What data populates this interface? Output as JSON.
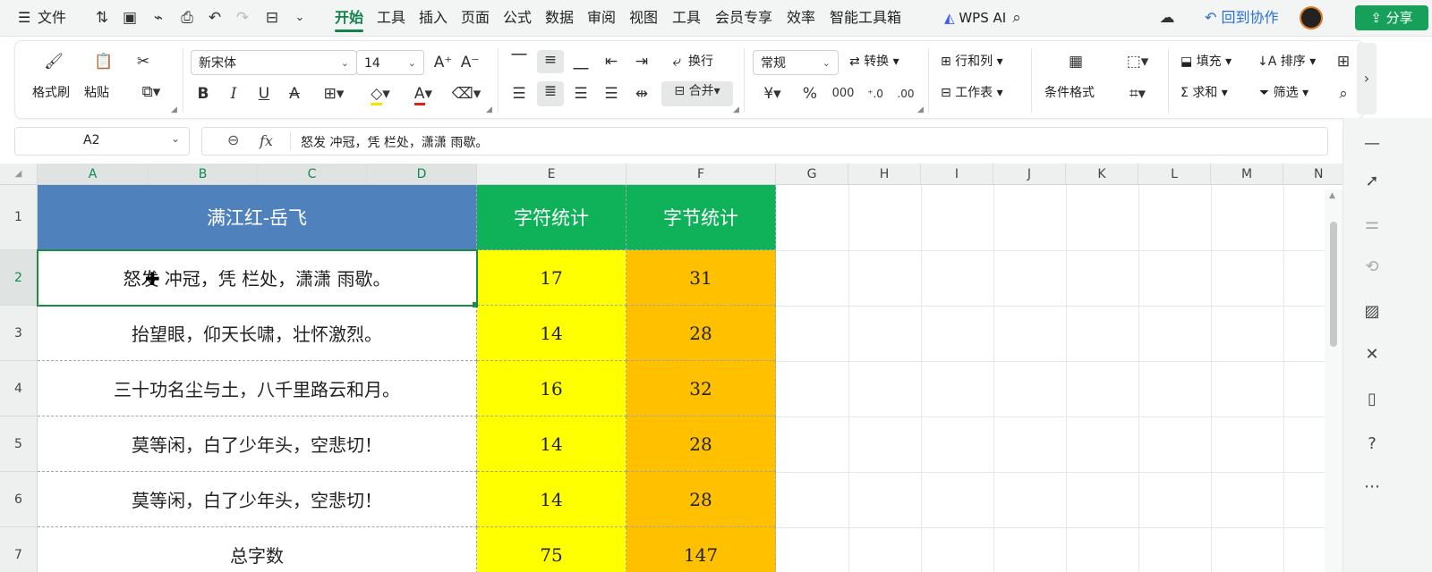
{
  "menubar": {
    "file_label": "文件",
    "tabs": [
      "开始",
      "工具",
      "插入",
      "页面",
      "公式",
      "数据",
      "审阅",
      "视图",
      "工具",
      "会员专享",
      "效率",
      "智能工具箱"
    ],
    "active_tab": "开始",
    "wps_ai": "WPS AI",
    "back_to_collab": "回到协作",
    "share": "分享"
  },
  "ribbon": {
    "format_painter": "格式刷",
    "paste": "粘贴",
    "font_name": "新宋体",
    "font_size": "14",
    "wrap": "换行",
    "merge": "合并",
    "number_format": "常规",
    "convert": "转换",
    "row_col": "行和列",
    "worksheet": "工作表",
    "cond_format": "条件格式",
    "fill": "填充",
    "sort": "排序",
    "sum": "求和",
    "filter": "筛选"
  },
  "formula_bar": {
    "name_box": "A2",
    "fx": "fx",
    "content": "怒发 冲冠，凭 栏处，潇潇 雨歇。"
  },
  "grid": {
    "columns": [
      "A",
      "B",
      "C",
      "D",
      "E",
      "F",
      "G",
      "H",
      "I",
      "J",
      "K",
      "L",
      "M",
      "N"
    ],
    "rows": [
      "1",
      "2",
      "3",
      "4",
      "5",
      "6",
      "7"
    ],
    "header": {
      "title": "满江红-岳飞",
      "char_count": "字符统计",
      "byte_count": "字节统计"
    },
    "data": [
      {
        "text": "怒发 冲冠，凭 栏处，潇潇 雨歇。",
        "chars": "17",
        "bytes": "31"
      },
      {
        "text": "抬望眼，仰天长啸，壮怀激烈。",
        "chars": "14",
        "bytes": "28"
      },
      {
        "text": "三十功名尘与土，八千里路云和月。",
        "chars": "16",
        "bytes": "32"
      },
      {
        "text": "莫等闲，白了少年头，空悲切！",
        "chars": "14",
        "bytes": "28"
      },
      {
        "text": "莫等闲，白了少年头，空悲切！",
        "chars": "14",
        "bytes": "28"
      },
      {
        "text": "总字数",
        "chars": "75",
        "bytes": "147"
      }
    ],
    "selected_cell": "A2"
  },
  "colors": {
    "accent": "#12824b",
    "header_blue": "#4f81bd",
    "header_green": "#0fb259",
    "yellow": "#ffff00",
    "orange": "#ffc000"
  }
}
